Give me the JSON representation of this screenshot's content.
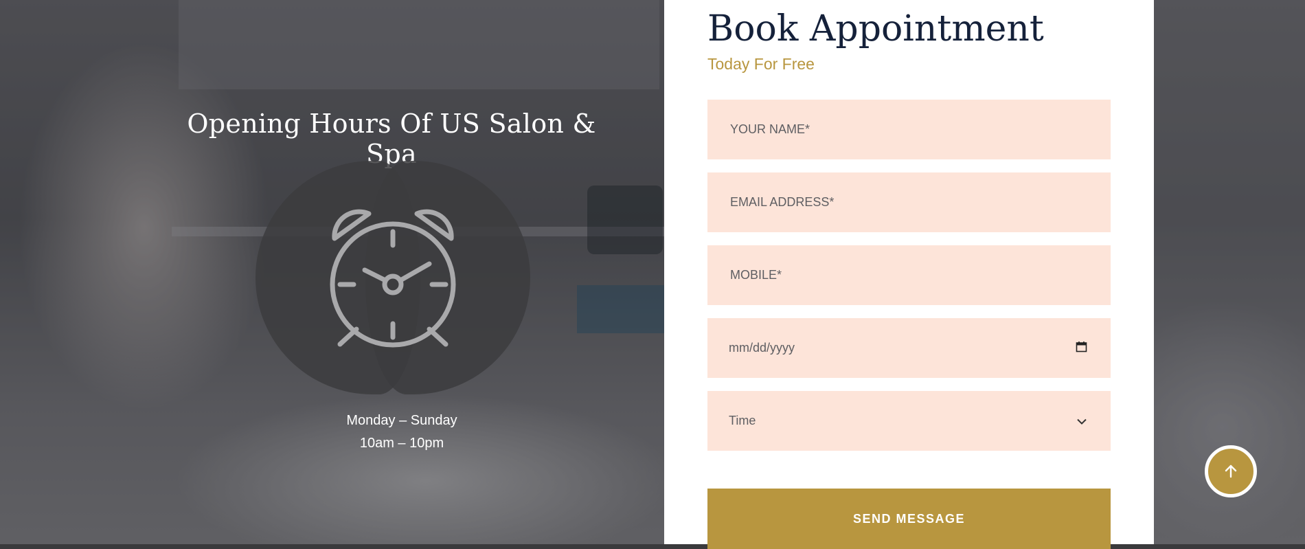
{
  "hours_section": {
    "title": "Opening Hours Of US Salon & Spa",
    "days": "Monday – Sunday",
    "time": "10am – 10pm",
    "icon": "alarm-clock-icon"
  },
  "booking": {
    "title": "Book Appointment",
    "subtitle": "Today For Free",
    "name_placeholder": "YOUR NAME*",
    "email_placeholder": "EMAIL ADDRESS*",
    "mobile_placeholder": "MOBILE*",
    "date_placeholder": "mm/dd/yyyy",
    "time_label": "Time",
    "submit_label": "SEND MESSAGE"
  },
  "icons": {
    "calendar": "calendar-icon",
    "chevron": "chevron-down-icon",
    "scroll_top": "arrow-up-icon"
  },
  "colors": {
    "accent": "#b8963f",
    "field_bg": "#fde4d9",
    "heading": "#15213a"
  }
}
